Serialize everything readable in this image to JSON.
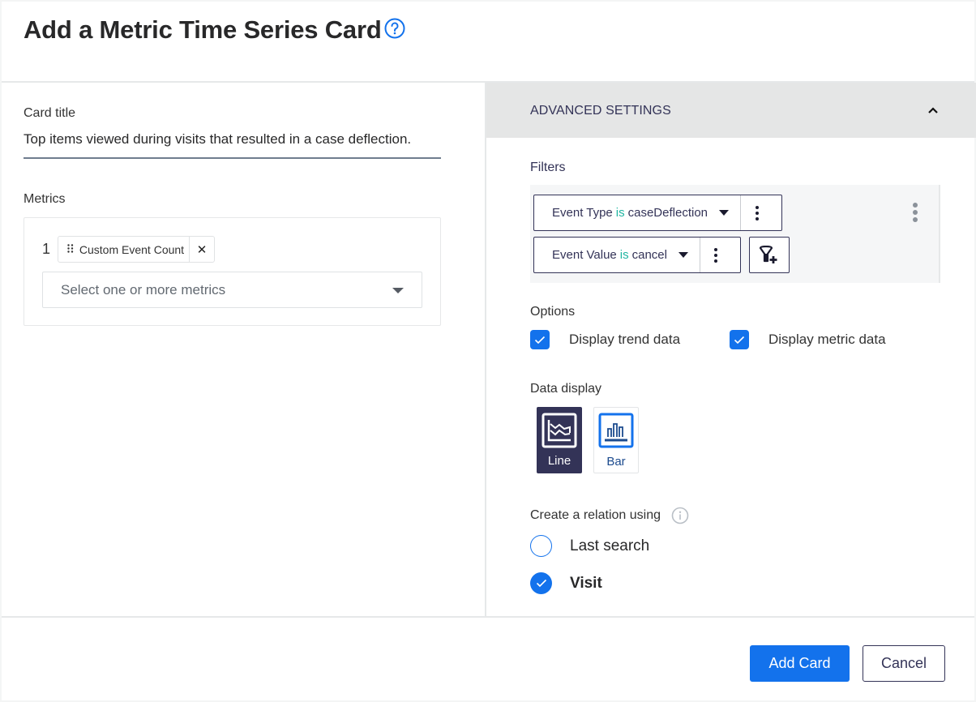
{
  "header": {
    "title": "Add a Metric Time Series Card",
    "help_icon": "help-circle-icon"
  },
  "card_title": {
    "label": "Card title",
    "value": "Top items viewed during visits that resulted in a case deflection."
  },
  "metrics": {
    "label": "Metrics",
    "items": [
      {
        "index": "1",
        "name": "Custom Event Count",
        "grip_icon": "drag-grip-icon",
        "remove_icon": "close-icon",
        "remove_glyph": "✕"
      }
    ],
    "select_placeholder": "Select one or more metrics"
  },
  "advanced": {
    "title": "ADVANCED SETTINGS",
    "expanded": true,
    "filters": {
      "label": "Filters",
      "items": [
        {
          "field": "Event Type",
          "operator": "is",
          "value": "caseDeflection"
        },
        {
          "field": "Event Value",
          "operator": "is",
          "value": "cancel"
        }
      ],
      "add_filter_icon": "filter-add-icon",
      "more_icon": "more-vertical-icon"
    },
    "options": {
      "label": "Options",
      "items": [
        {
          "label": "Display trend data",
          "checked": true
        },
        {
          "label": "Display metric data",
          "checked": true
        }
      ]
    },
    "data_display": {
      "label": "Data display",
      "items": [
        {
          "label": "Line",
          "selected": true,
          "icon": "line-chart-icon"
        },
        {
          "label": "Bar",
          "selected": false,
          "icon": "bar-chart-icon"
        }
      ]
    },
    "relation": {
      "label": "Create a relation using",
      "info_icon": "info-icon",
      "items": [
        {
          "label": "Last search",
          "selected": false
        },
        {
          "label": "Visit",
          "selected": true
        }
      ]
    }
  },
  "footer": {
    "primary_label": "Add Card",
    "secondary_label": "Cancel"
  },
  "colors": {
    "accent": "#1372ec",
    "navy": "#333357",
    "operator": "#1fb5a1",
    "panel_header": "#e5e6e6"
  }
}
